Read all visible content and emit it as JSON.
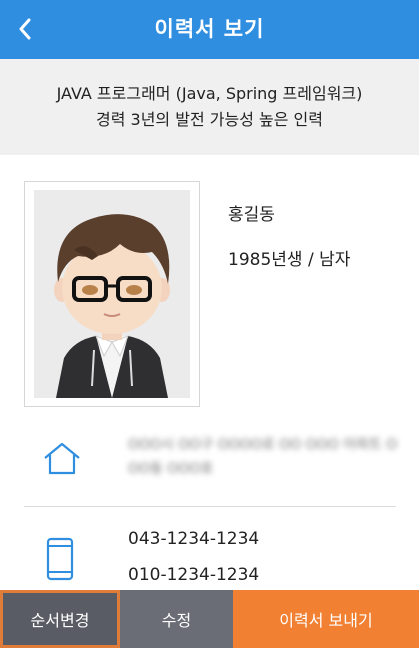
{
  "header": {
    "title": "이력서 보기",
    "back_icon": "chevron-left-icon"
  },
  "summary": {
    "line1": "JAVA 프로그래머 (Java, Spring 프레임워크)",
    "line2": "경력 3년의 발전 가능성 높은 인력"
  },
  "profile": {
    "name": "홍길동",
    "birth_gender": "1985년생 / 남자"
  },
  "contact": {
    "address_icon": "home-icon",
    "address": "OOO시 OO구 OOOO로 OO OOO 아파트 OOO동 OOO호",
    "phone_icon": "smartphone-icon",
    "phone1": "043-1234-1234",
    "phone2": "010-1234-1234"
  },
  "actions": {
    "reorder": "순서변경",
    "edit": "수정",
    "send": "이력서 보내기"
  },
  "colors": {
    "header_bg": "#2f8ee0",
    "summary_bg": "#f0f0f0",
    "icon_blue": "#2f8ee0",
    "btn_order_bg": "#5a5c65",
    "btn_order_border": "#e07b39",
    "btn_edit_bg": "#6b6d76",
    "btn_send_bg": "#f28033"
  }
}
